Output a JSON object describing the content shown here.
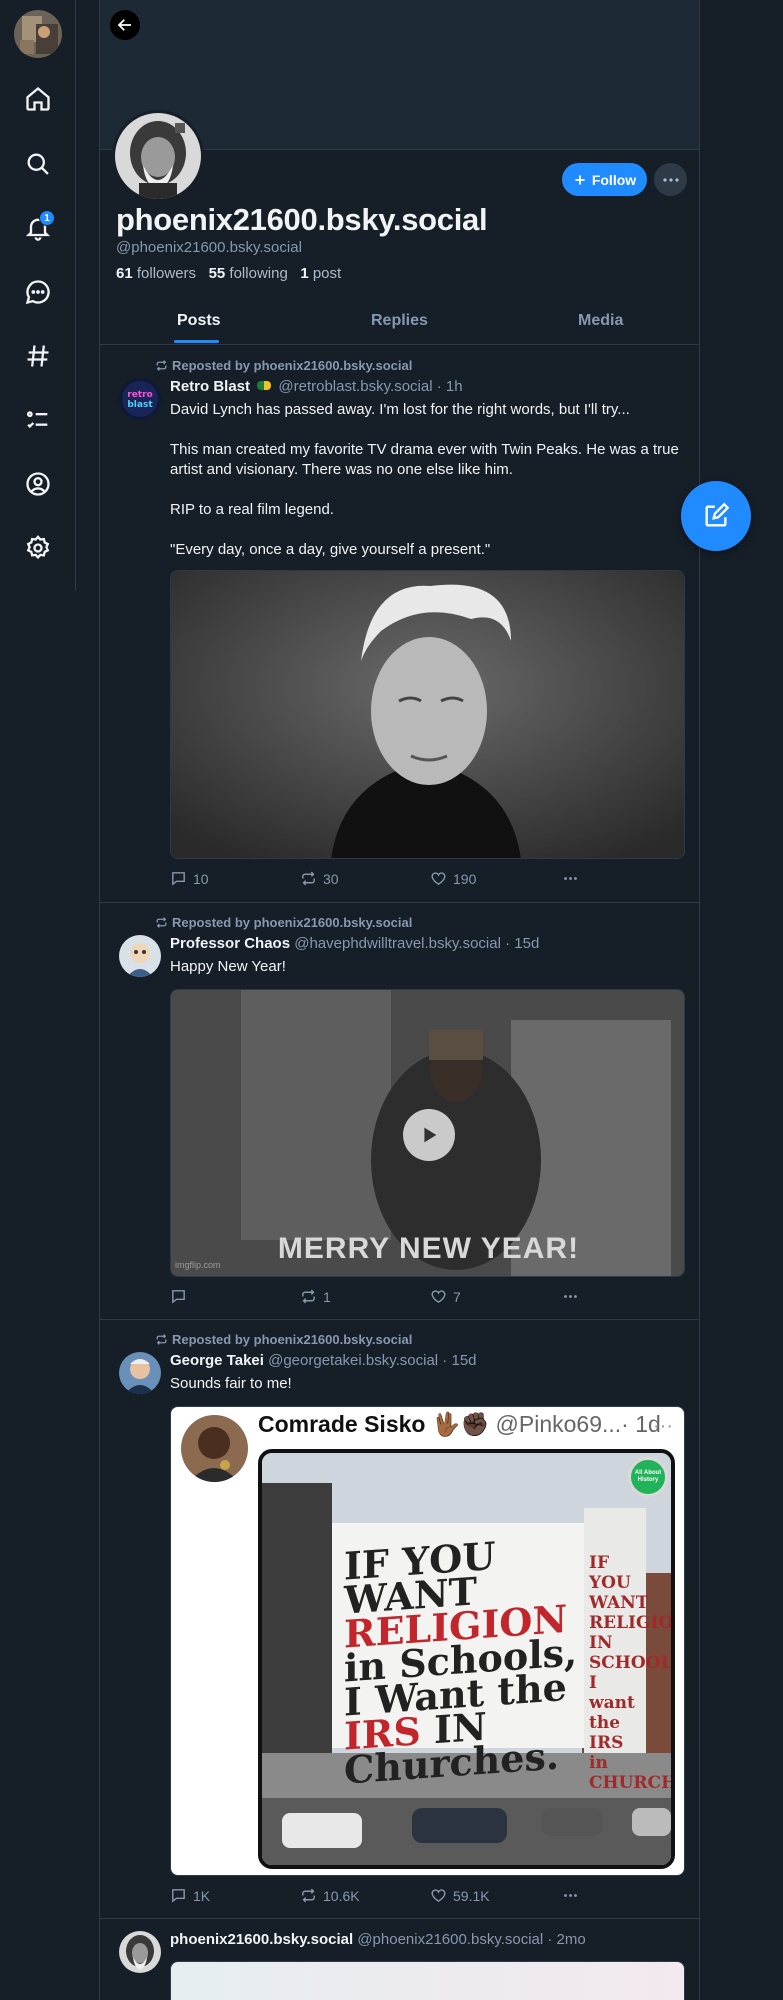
{
  "nav": {
    "notifications_badge": "1",
    "items": [
      "home-icon",
      "search-icon",
      "bell-icon",
      "chat-icon",
      "hashtag-icon",
      "list-icon",
      "profile-icon",
      "settings-icon"
    ]
  },
  "profile": {
    "display_name": "phoenix21600.bsky.social",
    "handle": "@phoenix21600.bsky.social",
    "followers_count": "61",
    "followers_label": "followers",
    "following_count": "55",
    "following_label": "following",
    "posts_count": "1",
    "posts_label": "post",
    "follow_label": "Follow"
  },
  "tabs": [
    "Posts",
    "Replies",
    "Media"
  ],
  "posts": [
    {
      "repost_label": "Reposted by phoenix21600.bsky.social",
      "name": "Retro Blast",
      "handle_time": "@retroblast.bsky.social · 1h",
      "text": "David Lynch has passed away. I'm lost for the right words, but I'll try...\n\nThis man created my favorite TV drama ever with Twin Peaks. He was a true artist and visionary. There was no one else like him.\n\nRIP to a real film legend.\n\n\"Every day, once a day, give yourself a present.\"",
      "replies": "10",
      "reposts": "30",
      "likes": "190",
      "avatar_text": "retro blast"
    },
    {
      "repost_label": "Reposted by phoenix21600.bsky.social",
      "name": "Professor Chaos",
      "handle_time": "@havephdwilltravel.bsky.social · 15d",
      "text": "Happy New Year!",
      "replies": "",
      "reposts": "1",
      "likes": "7",
      "media_caption": "MERRY NEW YEAR!",
      "media_watermark": "imgflip.com"
    },
    {
      "repost_label": "Reposted by phoenix21600.bsky.social",
      "name": "George Takei",
      "handle_time": "@georgetakei.bsky.social · 15d",
      "text": "Sounds fair to me!",
      "replies": "1K",
      "reposts": "10.6K",
      "likes": "59.1K",
      "embed": {
        "name": "Comrade Sisko 🖖🏾✊🏿",
        "handle": "@Pinko69...",
        "time": "· 1d",
        "billboard_lines": [
          "IF YOU WANT",
          "RELIGION",
          "in Schools,",
          "I Want the",
          "IRS",
          "IN",
          "Churches."
        ],
        "side_lines": [
          "IF YOU WANT",
          "RELIGION",
          "IN SCHOOLS,",
          "I want the",
          "IRS in",
          "CHURCHES"
        ],
        "badge": "All About History"
      }
    },
    {
      "name": "phoenix21600.bsky.social",
      "handle_time": "@phoenix21600.bsky.social · 2mo"
    }
  ],
  "colors": {
    "background": "#161e27",
    "accent": "#208bfe",
    "muted": "#8798b0",
    "border": "#2e3a48"
  }
}
